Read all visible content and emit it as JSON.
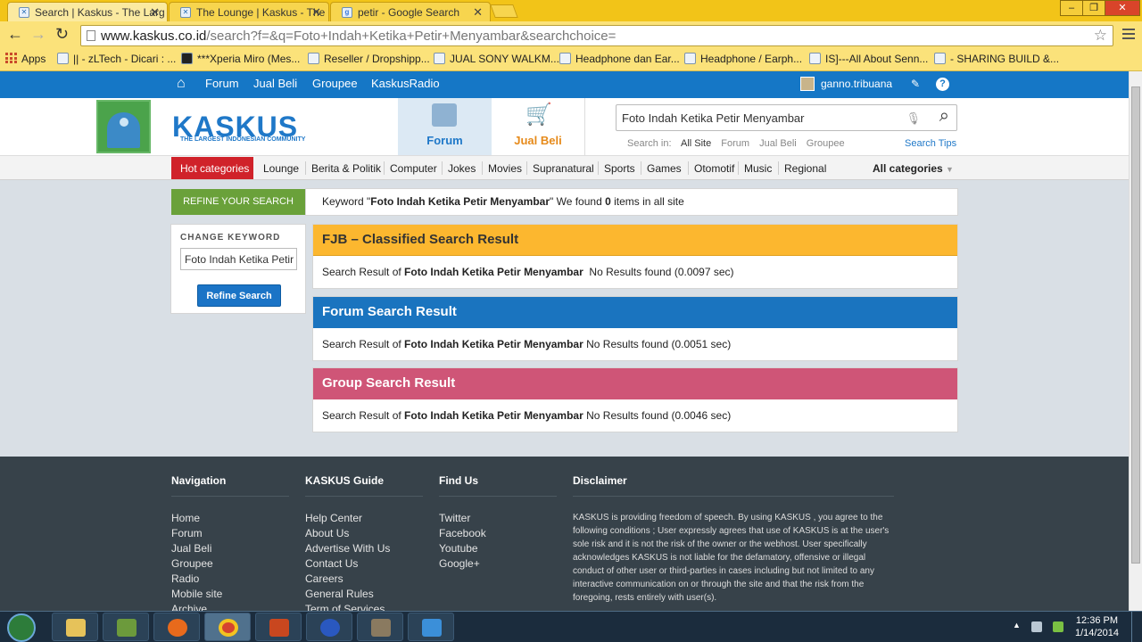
{
  "browser": {
    "tabs": [
      {
        "title": "Search | Kaskus - The Larg",
        "active": true
      },
      {
        "title": "The Lounge | Kaskus - The",
        "active": false
      },
      {
        "title": "petir - Google Search",
        "active": false
      }
    ],
    "url_host": "www.kaskus.co.id",
    "url_path": "/search?f=&q=Foto+Indah+Ketika+Petir+Menyambar&searchchoice=",
    "bookmarks": [
      "Apps",
      "|| - zLTech - Dicari : ...",
      "***Xperia Miro (Mes...",
      "Reseller / Dropshipp...",
      "JUAL SONY WALKM...",
      "Headphone dan Ear...",
      "Headphone / Earph...",
      "IS]---All About Senn...",
      "- SHARING BUILD &..."
    ]
  },
  "kaskus_nav": {
    "items": [
      "Forum",
      "Jual Beli",
      "Groupee",
      "KaskusRadio"
    ],
    "username": "ganno.tribuana"
  },
  "header": {
    "logo_text": "KASKUS",
    "tagline": "THE LARGEST INDONESIAN COMMUNITY",
    "tab_forum": "Forum",
    "tab_jualbeli": "Jual Beli",
    "search_value": "Foto Indah Ketika Petir Menyambar",
    "search_in_label": "Search in:",
    "search_in_options": [
      "All Site",
      "Forum",
      "Jual Beli",
      "Groupee"
    ],
    "search_tips": "Search Tips"
  },
  "categories": {
    "hot": "Hot categories",
    "items": [
      "Lounge",
      "Berita & Politik",
      "Computer",
      "Jokes",
      "Movies",
      "Supranatural",
      "Sports",
      "Games",
      "Otomotif",
      "Music",
      "Regional"
    ],
    "all": "All categories"
  },
  "search": {
    "refine_title": "REFINE YOUR SEARCH",
    "keyword_prefix": "Keyword \"",
    "keyword": "Foto Indah Ketika Petir Menyambar",
    "keyword_suffix_1": "\" We found ",
    "found_count": "0",
    "keyword_suffix_2": " items in all site",
    "change_keyword_title": "CHANGE KEYWORD",
    "change_keyword_value": "Foto Indah Ketika Petir Menyambar",
    "refine_button": "Refine Search"
  },
  "results": [
    {
      "id": "fjb",
      "title": "FJB – Classified Search Result",
      "prefix": "Search Result of ",
      "query": "Foto Indah Ketika Petir Menyambar",
      "status": "  No Results found (0.0097 sec)"
    },
    {
      "id": "forum",
      "title": "Forum Search Result",
      "prefix": "Search Result of ",
      "query": "Foto Indah Ketika Petir Menyambar",
      "status": " No Results found (0.0051 sec)"
    },
    {
      "id": "group",
      "title": "Group Search Result",
      "prefix": "Search Result of ",
      "query": "Foto Indah Ketika Petir Menyambar",
      "status": " No Results found (0.0046 sec)"
    }
  ],
  "footer": {
    "navigation": {
      "title": "Navigation",
      "links": [
        "Home",
        "Forum",
        "Jual Beli",
        "Groupee",
        "Radio",
        "Mobile site",
        "Archive"
      ]
    },
    "guide": {
      "title": "KASKUS Guide",
      "links": [
        "Help Center",
        "About Us",
        "Advertise With Us",
        "Contact Us",
        "Careers",
        "General Rules",
        "Term of Services"
      ]
    },
    "findus": {
      "title": "Find Us",
      "links": [
        "Twitter",
        "Facebook",
        "Youtube",
        "Google+"
      ]
    },
    "disclaimer": {
      "title": "Disclaimer",
      "text": "KASKUS is providing freedom of speech. By using KASKUS , you agree to the following conditions ; User expressly agrees that use of KASKUS is at the user's sole risk and it is not the risk of the owner or the webhost. User specifically acknowledges KASKUS is not liable for the defamatory, offensive or illegal conduct of other user or third-parties in cases including but not limited to any interactive communication on or through the site and that the risk from the foregoing, rests entirely with user(s)."
    }
  },
  "taskbar": {
    "time": "12:36 PM",
    "date": "1/14/2014",
    "app_icons": [
      "explorer-icon",
      "evernote-icon",
      "firefox-icon",
      "chrome-icon",
      "game-icon",
      "3g-modem-icon",
      "game2-icon",
      "wifi-icon"
    ]
  },
  "colors": {
    "kaskus_blue": "#1577c6",
    "fjb_header": "#fcb72f",
    "forum_header": "#1a74bf",
    "group_header": "#cf5577",
    "refine_green": "#6aa13a",
    "hot_red": "#d0222a"
  }
}
